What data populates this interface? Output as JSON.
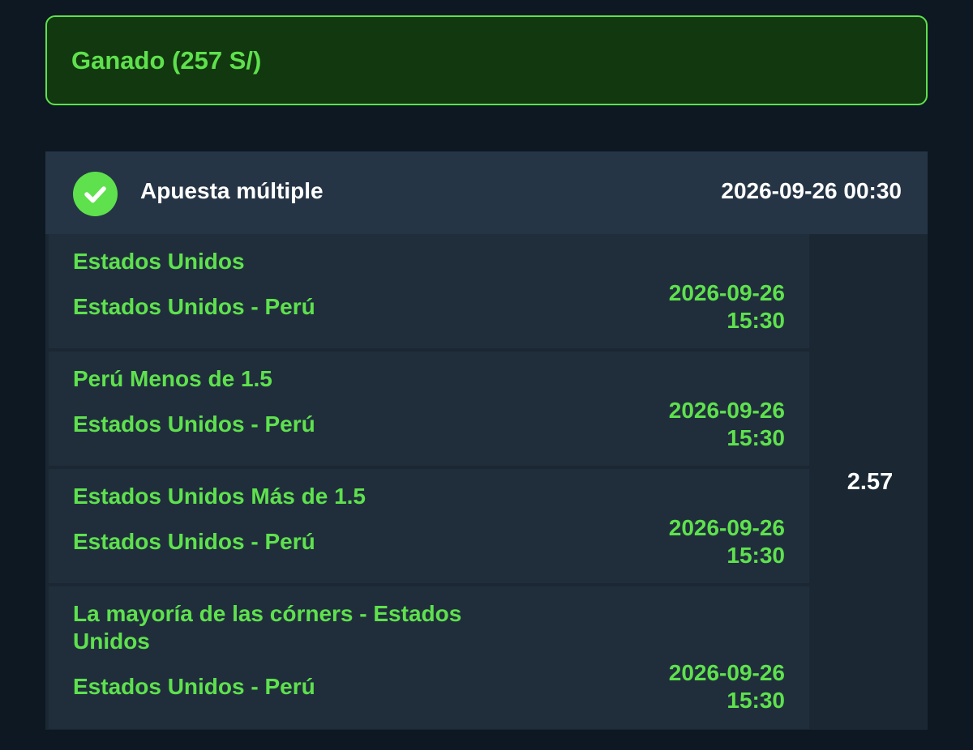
{
  "status": {
    "text": "Ganado (257 S/)"
  },
  "bet": {
    "type_label": "Apuesta múltiple",
    "datetime": "2026-09-26 00:30",
    "odds": "2.57",
    "selections": [
      {
        "pick": "Estados Unidos",
        "match": "Estados Unidos - Perú",
        "date": "2026-09-26",
        "time": "15:30"
      },
      {
        "pick": "Perú Menos de 1.5",
        "match": "Estados Unidos - Perú",
        "date": "2026-09-26",
        "time": "15:30"
      },
      {
        "pick": "Estados Unidos Más de 1.5",
        "match": "Estados Unidos - Perú",
        "date": "2026-09-26",
        "time": "15:30"
      },
      {
        "pick": "La mayoría de las córners - Estados Unidos",
        "match": "Estados Unidos - Perú",
        "date": "2026-09-26",
        "time": "15:30"
      }
    ]
  },
  "icons": {
    "status_icon": "check-circle-icon"
  },
  "colors": {
    "accent_green": "#5ee14d",
    "banner_bg": "#12380f",
    "page_bg": "#0d1822"
  }
}
